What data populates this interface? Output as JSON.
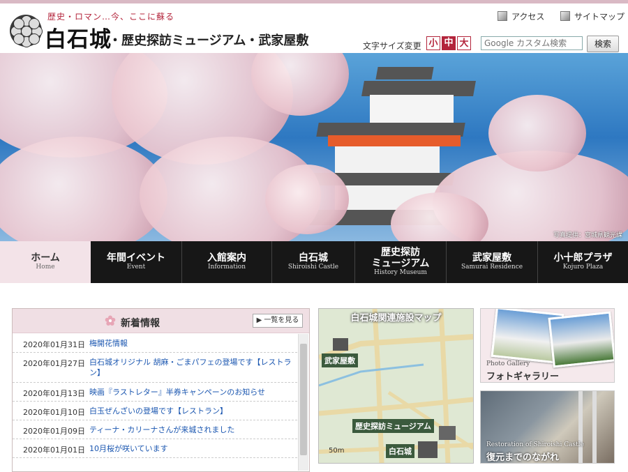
{
  "header": {
    "tagline": "歴史・ロマン…今、ここに蘇る",
    "brand": "白石城",
    "subtitle": "・歴史探訪ミュージアム・武家屋敷",
    "util_nav": [
      {
        "label": "アクセス",
        "icon": "cube-icon"
      },
      {
        "label": "サイトマップ",
        "icon": "cube-icon"
      }
    ],
    "font_size_label": "文字サイズ変更",
    "font_sizes": [
      "小",
      "中",
      "大"
    ],
    "search": {
      "placeholder": "Google カスタム検索",
      "button": "検索"
    }
  },
  "hero": {
    "credit": "写真提供：宮城県観光課"
  },
  "nav": [
    {
      "jp": "ホーム",
      "en": "Home",
      "active": true
    },
    {
      "jp": "年間イベント",
      "en": "Event"
    },
    {
      "jp": "入館案内",
      "en": "Information"
    },
    {
      "jp": "白石城",
      "en": "Shiroishi Castle"
    },
    {
      "jp": "歴史探訪\nミュージアム",
      "en": "History Museum"
    },
    {
      "jp": "武家屋敷",
      "en": "Samurai Residence"
    },
    {
      "jp": "小十郎プラザ",
      "en": "Kojuro Plaza"
    }
  ],
  "news": {
    "title": "新着情報",
    "more": "▶ 一覧を見る",
    "items": [
      {
        "date": "2020年01月31日",
        "text": "梅開花情報"
      },
      {
        "date": "2020年01月27日",
        "text": "白石城オリジナル 胡麻・ごまパフェの登場です【レストラン】"
      },
      {
        "date": "2020年01月13日",
        "text": "映画『ラストレター』半券キャンペーンのお知らせ"
      },
      {
        "date": "2020年01月10日",
        "text": "白玉ぜんざいの登場です【レストラン】"
      },
      {
        "date": "2020年01月09日",
        "text": "ティーナ・カリーナさんが来城されました"
      },
      {
        "date": "2020年01月01日",
        "text": "10月桜が咲いています"
      }
    ]
  },
  "map": {
    "title": "白石城関連施設マップ",
    "labels": {
      "samurai": "武家屋敷",
      "museum": "歴史探訪ミュージアム",
      "castle": "白石城"
    },
    "scale": "50m"
  },
  "gallery": {
    "en": "Photo Gallery",
    "jp": "フォトギャラリー"
  },
  "restoration": {
    "en": "Restoration of Shiroishi Castle",
    "jp": "復元までのながれ"
  },
  "colors": {
    "accent": "#b3243b",
    "nav_bg": "#171717",
    "pink": "#f0dfe4",
    "link": "#1a56b0"
  }
}
